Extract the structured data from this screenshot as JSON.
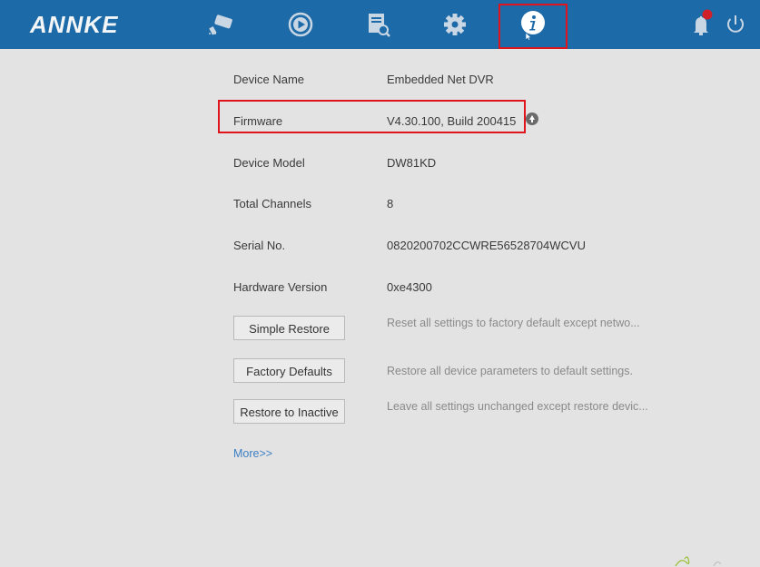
{
  "app": {
    "logo": "ANNKE"
  },
  "nav": {
    "items": [
      {
        "name": "camera",
        "icon": "camera-icon"
      },
      {
        "name": "playback",
        "icon": "playback-icon"
      },
      {
        "name": "search",
        "icon": "file-search-icon"
      },
      {
        "name": "settings",
        "icon": "gear-icon"
      },
      {
        "name": "info",
        "icon": "info-icon",
        "active": true
      }
    ],
    "right": [
      {
        "name": "alarm",
        "icon": "bell-icon",
        "badge_color": "#d0202a"
      },
      {
        "name": "power",
        "icon": "power-icon"
      }
    ]
  },
  "info": {
    "device_name": {
      "label": "Device Name",
      "value": "Embedded Net DVR"
    },
    "firmware": {
      "label": "Firmware",
      "value": "V4.30.100, Build 200415"
    },
    "device_model": {
      "label": "Device Model",
      "value": "DW81KD"
    },
    "total_channels": {
      "label": "Total Channels",
      "value": "8"
    },
    "serial_no": {
      "label": "Serial No.",
      "value": "0820200702CCWRE56528704WCVU"
    },
    "hardware_version": {
      "label": "Hardware Version",
      "value": "0xe4300"
    }
  },
  "actions": {
    "simple_restore": {
      "label": "Simple Restore",
      "desc": "Reset all settings to factory default except netwo..."
    },
    "factory_defaults": {
      "label": "Factory Defaults",
      "desc": "Restore all device parameters to default settings."
    },
    "restore_inactive": {
      "label": "Restore to Inactive",
      "desc": "Leave all settings unchanged except restore devic..."
    }
  },
  "more_link": "More>>",
  "colors": {
    "topbar": "#1d6aa8",
    "highlight": "#e0141c",
    "link": "#3c7fc2"
  }
}
